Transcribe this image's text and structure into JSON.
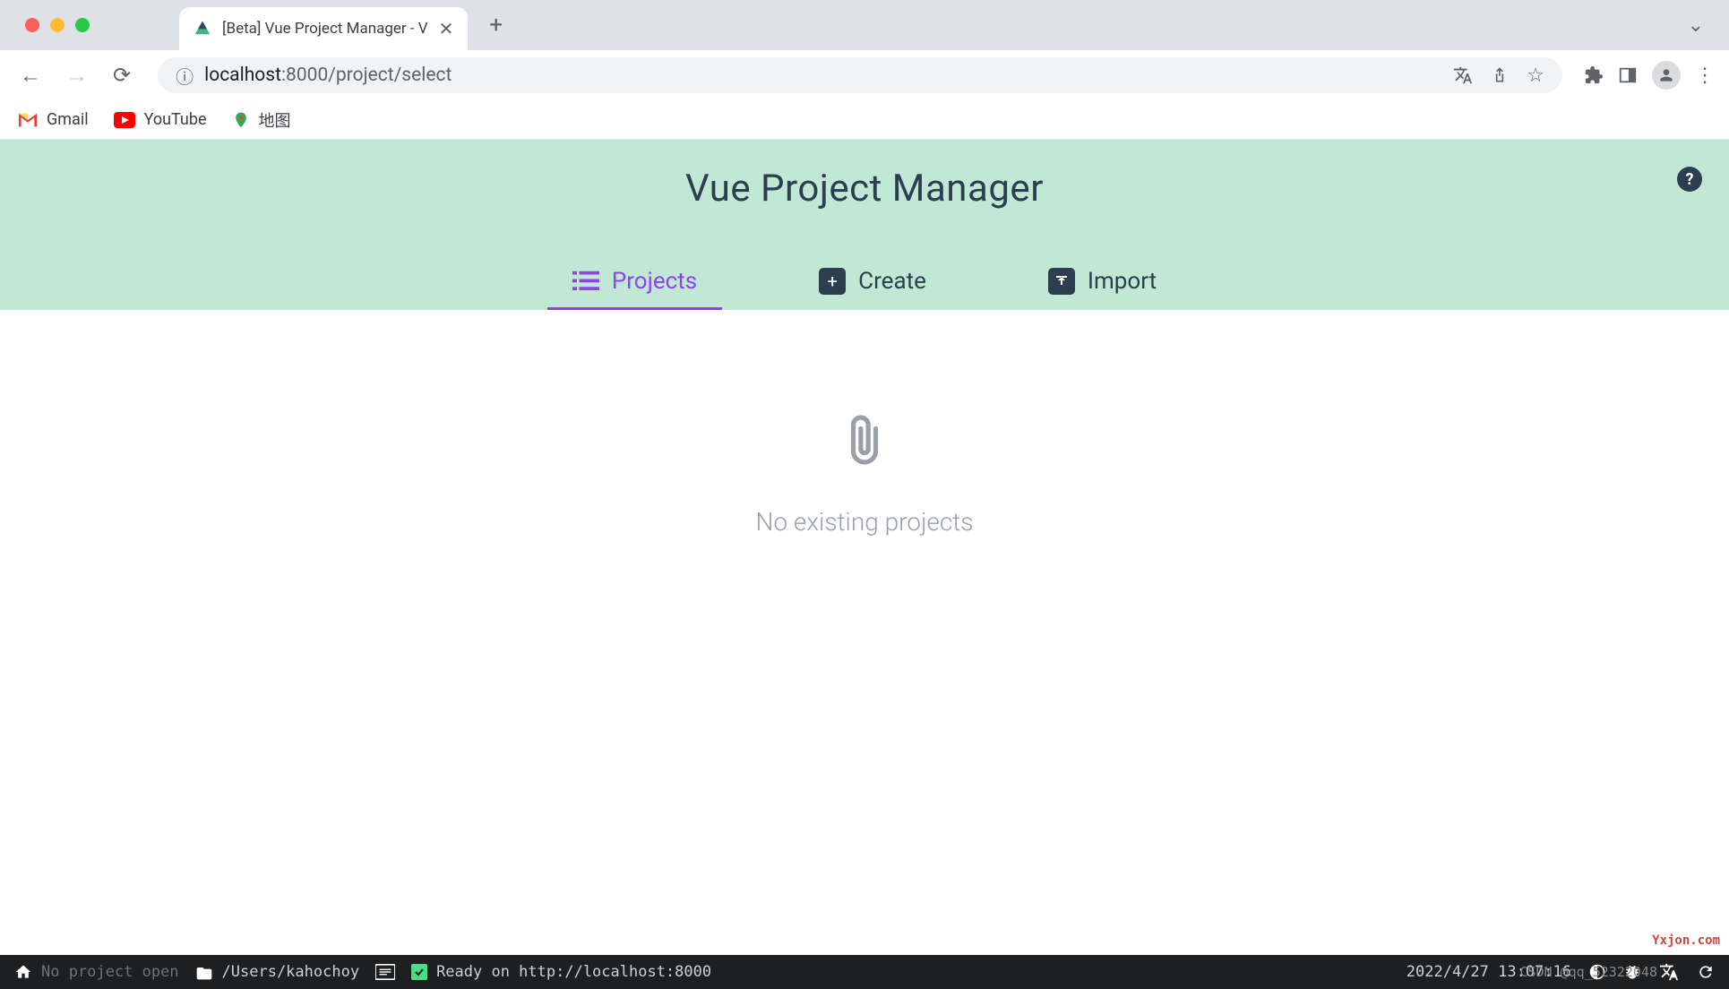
{
  "browser": {
    "tab_title": "[Beta] Vue Project Manager - V",
    "url_host": "localhost",
    "url_port": ":8000",
    "url_path": "/project/select"
  },
  "bookmarks": [
    {
      "label": "Gmail",
      "icon": "gmail"
    },
    {
      "label": "YouTube",
      "icon": "youtube"
    },
    {
      "label": "地图",
      "icon": "maps"
    }
  ],
  "app": {
    "title": "Vue Project Manager",
    "tabs": [
      {
        "label": "Projects",
        "icon": "list",
        "active": true
      },
      {
        "label": "Create",
        "icon": "plus",
        "active": false
      },
      {
        "label": "Import",
        "icon": "upload",
        "active": false
      }
    ],
    "empty_message": "No existing projects"
  },
  "status_bar": {
    "project_status": "No project open",
    "path": "/Users/kahochoy",
    "ready_message": "Ready on http://localhost:8000",
    "timestamp": "2022/4/27 13:07:16",
    "csdn": "CSDN @qq_52322048"
  },
  "watermark": "Yxjon.com"
}
